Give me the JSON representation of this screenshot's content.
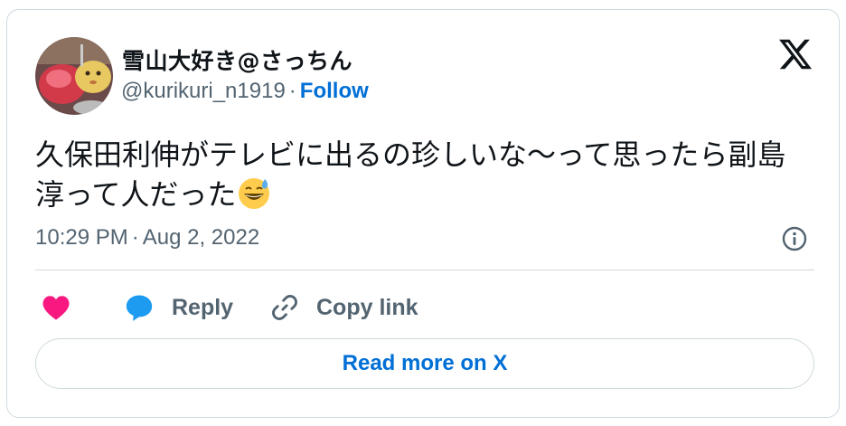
{
  "author": {
    "display_name": "雪山大好き@さっちん",
    "handle": "@kurikuri_n1919",
    "separator": "·",
    "follow_label": "Follow"
  },
  "tweet": {
    "text": "久保田利伸がテレビに出るの珍しいな〜って思ったら副島淳って人だった",
    "emoji": "grinning-face-with-sweat-emoji"
  },
  "meta": {
    "time": "10:29 PM",
    "separator": "·",
    "date": "Aug 2, 2022"
  },
  "actions": {
    "like_icon": "heart-icon",
    "reply_label": "Reply",
    "copy_link_label": "Copy link"
  },
  "read_more_label": "Read more on X",
  "colors": {
    "accent": "#006fd6",
    "heart": "#f91880",
    "reply_bubble": "#1d9bf0",
    "secondary_text": "#536471",
    "border": "#cfd9de"
  }
}
